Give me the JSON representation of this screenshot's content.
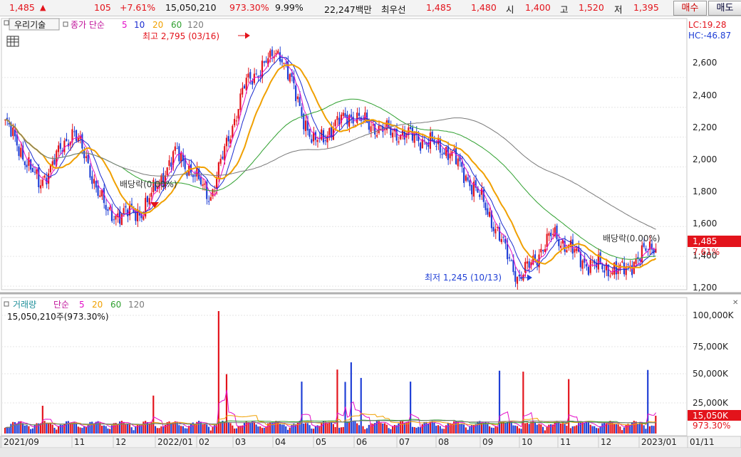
{
  "quote": {
    "price": "1,485",
    "up_arrow": "▲",
    "change": "105",
    "change_pct": "+7.61%",
    "volume": "15,050,210",
    "volume_ratio": "973.30%",
    "turnover_rate": "9.99%",
    "amount": "22,247백만",
    "best_offer_label": "최우선",
    "best_ask": "1,485",
    "best_bid": "1,480",
    "open_label": "시",
    "open": "1,400",
    "high_label": "고",
    "high": "1,520",
    "low_label": "저",
    "low": "1,395",
    "buy_button": "매수",
    "sell_button": "매도"
  },
  "price_panel": {
    "stock_name": "우리기술",
    "ma_legend": {
      "prefix": "종가 단순",
      "p5": "5",
      "p10": "10",
      "p20": "20",
      "p60": "60",
      "p120": "120"
    },
    "lc": "LC:19.28",
    "hc": "HC:-46.87",
    "current_price_tag": "1,485",
    "current_pct_tag": "7.61%",
    "high_annotation": "최고 2,795 (03/16)",
    "low_annotation": "최저 1,245 (10/13)",
    "dividend_label_1": "배당락(0.00%)",
    "dividend_label_2": "배당락(0.00%)",
    "y_ticks": [
      "2,600",
      "2,400",
      "2,200",
      "2,000",
      "1,800",
      "1,600",
      "1,400",
      "1,200"
    ],
    "colors": {
      "up": "#e3131b",
      "down": "#1f3fd6",
      "ma5": "#e30ec8",
      "ma10": "#1a2bd0",
      "ma20": "#f0a000",
      "ma60": "#2fa02f",
      "ma120": "#7a7a7a"
    }
  },
  "volume_panel": {
    "title": "거래량",
    "ma_legend": {
      "prefix": "단순",
      "p5": "5",
      "p20": "20",
      "p60": "60",
      "p120": "120"
    },
    "info": "15,050,210주(973.30%)",
    "y_ticks": [
      "100,000K",
      "75,000K",
      "50,000K",
      "25,000K"
    ],
    "current_volume_tag": "15,050K",
    "current_pct_tag": "973.30%"
  },
  "x_axis": {
    "labels": [
      "2021/09",
      "11",
      "12",
      "2022/01",
      "02",
      "03",
      "04",
      "05",
      "06",
      "07",
      "08",
      "09",
      "10",
      "11",
      "12",
      "2023/01",
      "01/11"
    ]
  },
  "chart_data": {
    "type": "candlestick",
    "title": "우리기술",
    "y_range": [
      1200,
      2750
    ],
    "approx_close_path": [
      {
        "x": "2021/09",
        "y": 2300
      },
      {
        "x": "10",
        "y": 1880
      },
      {
        "x": "11",
        "y": 2250
      },
      {
        "x": "12",
        "y": 1680
      },
      {
        "x": "2022/01",
        "y": 1700
      },
      {
        "x": "01-late",
        "y": 2100
      },
      {
        "x": "02",
        "y": 1800
      },
      {
        "x": "03",
        "y": 2550
      },
      {
        "x": "03/16",
        "y": 2795
      },
      {
        "x": "04",
        "y": 2150
      },
      {
        "x": "05",
        "y": 2350
      },
      {
        "x": "06",
        "y": 2250
      },
      {
        "x": "07",
        "y": 2200
      },
      {
        "x": "08",
        "y": 2100
      },
      {
        "x": "09",
        "y": 1750
      },
      {
        "x": "10/13",
        "y": 1245
      },
      {
        "x": "11",
        "y": 1550
      },
      {
        "x": "12",
        "y": 1350
      },
      {
        "x": "2023/01",
        "y": 1300
      },
      {
        "x": "01/11",
        "y": 1485
      }
    ]
  }
}
